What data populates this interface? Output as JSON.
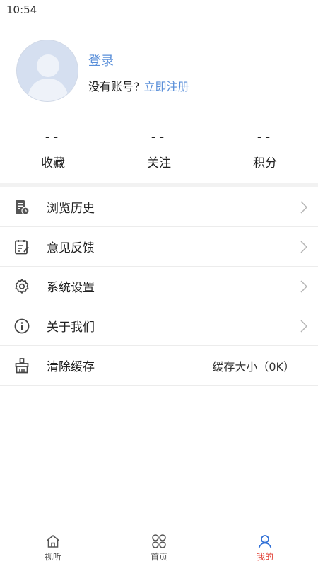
{
  "status_bar": {
    "time": "10:54"
  },
  "profile": {
    "login_label": "登录",
    "no_account_text": "没有账号?",
    "register_label": "立即注册",
    "avatar_icon": "default-avatar-icon"
  },
  "stats": [
    {
      "value": "--",
      "label": "收藏"
    },
    {
      "value": "--",
      "label": "关注"
    },
    {
      "value": "--",
      "label": "积分"
    }
  ],
  "menu": {
    "items": [
      {
        "label": "浏览历史",
        "icon": "history-icon"
      },
      {
        "label": "意见反馈",
        "icon": "feedback-icon"
      },
      {
        "label": "系统设置",
        "icon": "settings-icon"
      },
      {
        "label": "关于我们",
        "icon": "info-icon"
      },
      {
        "label": "清除缓存",
        "icon": "broom-icon",
        "value": "缓存大小（0K）"
      }
    ]
  },
  "tabbar": {
    "tabs": [
      {
        "label": "视听",
        "icon": "home-icon"
      },
      {
        "label": "首页",
        "icon": "grid-icon"
      },
      {
        "label": "我的",
        "icon": "user-icon",
        "active": true
      }
    ]
  },
  "colors": {
    "link": "#5a8fd9",
    "active_tab": "#e03a2f",
    "avatar_bg": "#d5dff0"
  }
}
